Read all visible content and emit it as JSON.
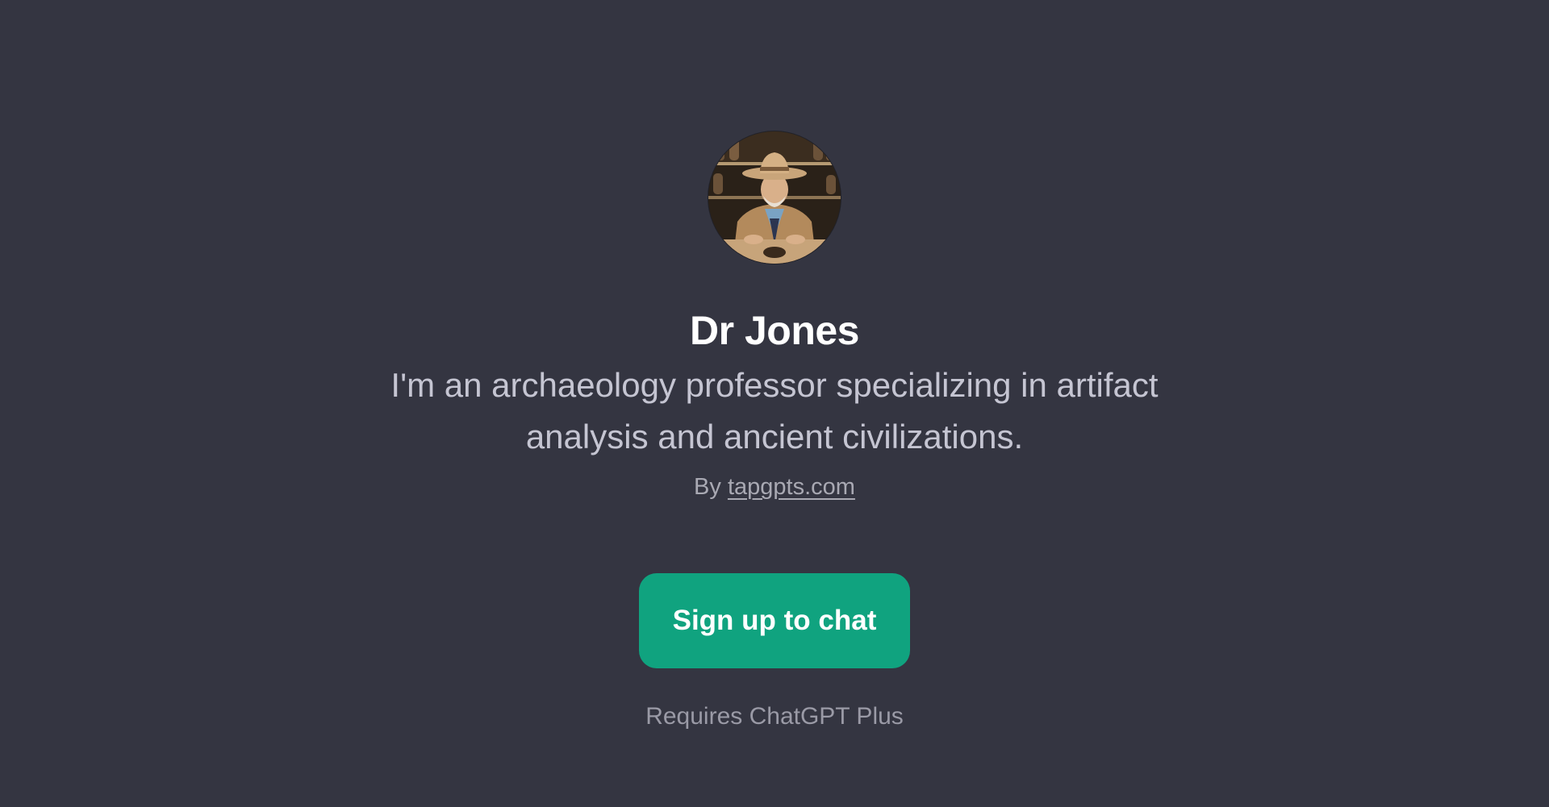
{
  "gpt": {
    "name": "Dr Jones",
    "description": "I'm an archaeology professor specializing in artifact analysis and ancient civilizations.",
    "byline_prefix": "By ",
    "author_link": "tapgpts.com",
    "avatar_icon": "archaeologist-portrait"
  },
  "actions": {
    "signup_label": "Sign up to chat",
    "requirement_note": "Requires ChatGPT Plus"
  },
  "colors": {
    "background": "#343541",
    "accent": "#10a37f",
    "title": "#ffffff",
    "text": "#c5c5d2",
    "muted": "#9a9aa6"
  }
}
